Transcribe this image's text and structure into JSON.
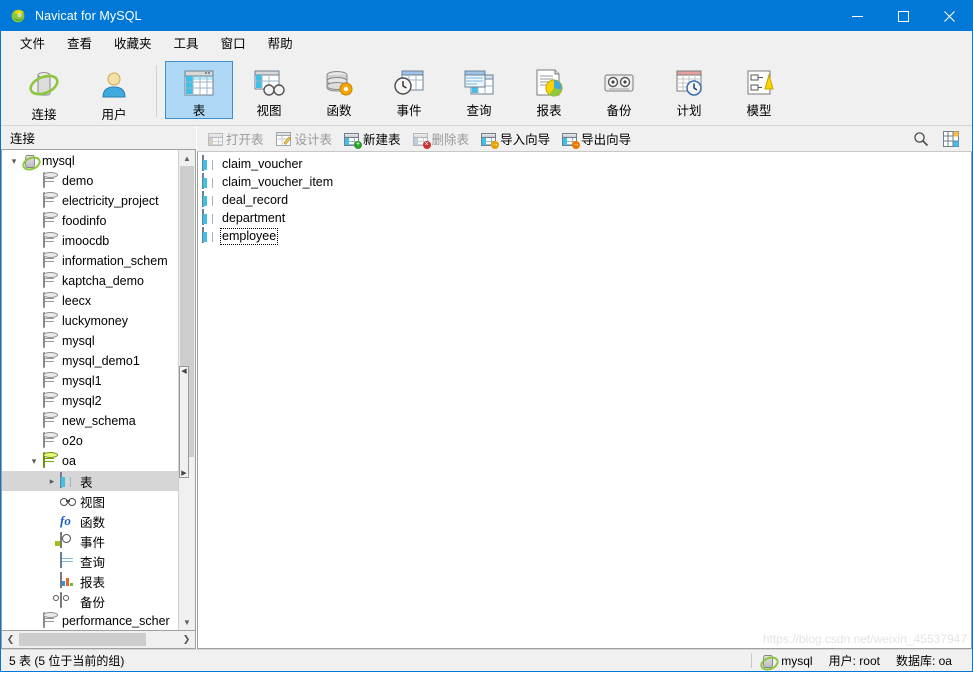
{
  "window": {
    "title": "Navicat for MySQL",
    "app_icon": "navicat-logo-icon",
    "minimize_label": "—",
    "maximize_label": "☐",
    "close_label": "✕"
  },
  "menubar": {
    "items": [
      {
        "label": "文件",
        "name": "menu-file"
      },
      {
        "label": "查看",
        "name": "menu-view"
      },
      {
        "label": "收藏夹",
        "name": "menu-favorites"
      },
      {
        "label": "工具",
        "name": "menu-tools"
      },
      {
        "label": "窗口",
        "name": "menu-window"
      },
      {
        "label": "帮助",
        "name": "menu-help"
      }
    ]
  },
  "toolbar": {
    "groups": [
      {
        "buttons": [
          {
            "label": "连接",
            "icon": "connection-icon",
            "active": false
          },
          {
            "label": "用户",
            "icon": "user-icon",
            "active": false
          }
        ]
      },
      {
        "buttons": [
          {
            "label": "表",
            "icon": "table-icon",
            "active": true
          },
          {
            "label": "视图",
            "icon": "view-icon",
            "active": false
          },
          {
            "label": "函数",
            "icon": "function-icon",
            "active": false
          },
          {
            "label": "事件",
            "icon": "event-icon",
            "active": false
          },
          {
            "label": "查询",
            "icon": "query-icon",
            "active": false
          },
          {
            "label": "报表",
            "icon": "report-icon",
            "active": false
          },
          {
            "label": "备份",
            "icon": "backup-icon",
            "active": false
          },
          {
            "label": "计划",
            "icon": "schedule-icon",
            "active": false
          },
          {
            "label": "模型",
            "icon": "model-icon",
            "active": false
          }
        ]
      }
    ]
  },
  "sidebar": {
    "header": "连接",
    "nodes": [
      {
        "label": "mysql",
        "icon": "connection-icon",
        "indent": 0,
        "twist": "expanded",
        "selected": false
      },
      {
        "label": "demo",
        "icon": "database-icon",
        "indent": 1,
        "twist": "none",
        "selected": false
      },
      {
        "label": "electricity_project",
        "icon": "database-icon",
        "indent": 1,
        "twist": "none",
        "selected": false
      },
      {
        "label": "foodinfo",
        "icon": "database-icon",
        "indent": 1,
        "twist": "none",
        "selected": false
      },
      {
        "label": "imoocdb",
        "icon": "database-icon",
        "indent": 1,
        "twist": "none",
        "selected": false
      },
      {
        "label": "information_schem",
        "icon": "database-icon",
        "indent": 1,
        "twist": "none",
        "selected": false
      },
      {
        "label": "kaptcha_demo",
        "icon": "database-icon",
        "indent": 1,
        "twist": "none",
        "selected": false
      },
      {
        "label": "leecx",
        "icon": "database-icon",
        "indent": 1,
        "twist": "none",
        "selected": false
      },
      {
        "label": "luckymoney",
        "icon": "database-icon",
        "indent": 1,
        "twist": "none",
        "selected": false
      },
      {
        "label": "mysql",
        "icon": "database-icon",
        "indent": 1,
        "twist": "none",
        "selected": false
      },
      {
        "label": "mysql_demo1",
        "icon": "database-icon",
        "indent": 1,
        "twist": "none",
        "selected": false
      },
      {
        "label": "mysql1",
        "icon": "database-icon",
        "indent": 1,
        "twist": "none",
        "selected": false
      },
      {
        "label": "mysql2",
        "icon": "database-icon",
        "indent": 1,
        "twist": "none",
        "selected": false
      },
      {
        "label": "new_schema",
        "icon": "database-icon",
        "indent": 1,
        "twist": "none",
        "selected": false
      },
      {
        "label": "o2o",
        "icon": "database-icon",
        "indent": 1,
        "twist": "none",
        "selected": false
      },
      {
        "label": "oa",
        "icon": "database-icon-open",
        "indent": 1,
        "twist": "expanded",
        "selected": false
      },
      {
        "label": "表",
        "icon": "table-icon",
        "indent": 2,
        "twist": "collapsed",
        "selected": true
      },
      {
        "label": "视图",
        "icon": "view-icon",
        "indent": 2,
        "twist": "none",
        "selected": false
      },
      {
        "label": "函数",
        "icon": "function-icon",
        "indent": 2,
        "twist": "none",
        "selected": false
      },
      {
        "label": "事件",
        "icon": "event-icon",
        "indent": 2,
        "twist": "none",
        "selected": false
      },
      {
        "label": "查询",
        "icon": "query-icon",
        "indent": 2,
        "twist": "none",
        "selected": false
      },
      {
        "label": "报表",
        "icon": "report-icon",
        "indent": 2,
        "twist": "none",
        "selected": false
      },
      {
        "label": "备份",
        "icon": "backup-icon",
        "indent": 2,
        "twist": "none",
        "selected": false
      },
      {
        "label": "performance_scher",
        "icon": "database-icon",
        "indent": 1,
        "twist": "none",
        "selected": false
      }
    ]
  },
  "subtoolbar": {
    "buttons": [
      {
        "label": "打开表",
        "icon": "open-table-icon",
        "disabled": true
      },
      {
        "label": "设计表",
        "icon": "design-table-icon",
        "disabled": true
      },
      {
        "label": "新建表",
        "icon": "new-table-icon",
        "disabled": false
      },
      {
        "label": "删除表",
        "icon": "delete-table-icon",
        "disabled": true
      },
      {
        "label": "导入向导",
        "icon": "import-wizard-icon",
        "disabled": false
      },
      {
        "label": "导出向导",
        "icon": "export-wizard-icon",
        "disabled": false
      }
    ],
    "right_icons": [
      {
        "name": "search-icon"
      },
      {
        "name": "view-mode-icon"
      }
    ]
  },
  "objectlist": {
    "items": [
      {
        "name": "claim_voucher",
        "icon": "table-icon",
        "focused": false
      },
      {
        "name": "claim_voucher_item",
        "icon": "table-icon",
        "focused": false
      },
      {
        "name": "deal_record",
        "icon": "table-icon",
        "focused": false
      },
      {
        "name": "department",
        "icon": "table-icon",
        "focused": false
      },
      {
        "name": "employee",
        "icon": "table-icon",
        "focused": true
      }
    ],
    "watermark": "https://blog.csdn.net/weixin_45537947"
  },
  "statusbar": {
    "count_text": "5 表 (5 位于当前的组)",
    "connection": "mysql",
    "user": "用户: root",
    "database": "数据库: oa",
    "connection_icon": "connection-icon"
  },
  "colors": {
    "titlebar": "#0078d7",
    "toolbar_active_bg": "#aed8f5",
    "toolbar_active_border": "#3c8ed0",
    "tree_selection": "#d6d6d6",
    "chrome": "#f0f0f0"
  }
}
